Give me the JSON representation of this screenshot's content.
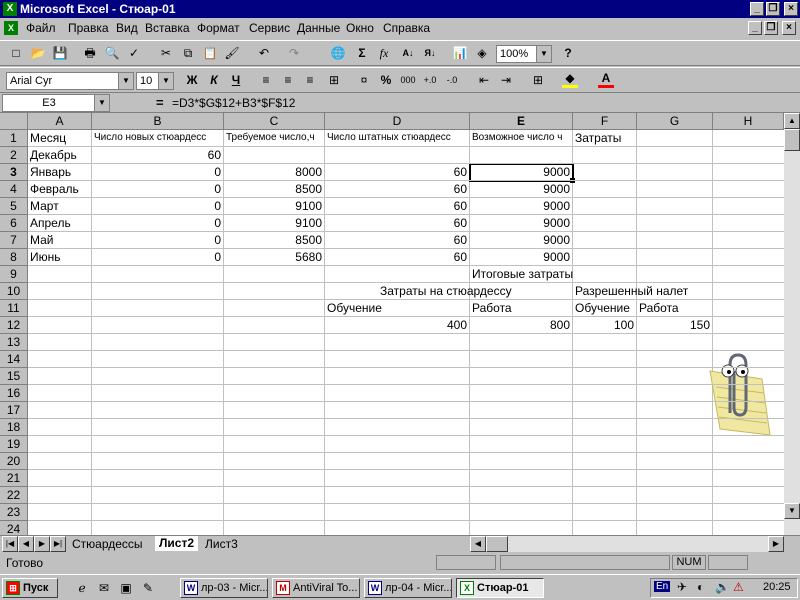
{
  "window": {
    "title": "Microsoft Excel - Стюар-01",
    "inner_controls": [
      "_",
      "❐",
      "×"
    ]
  },
  "menu": [
    "Файл",
    "Правка",
    "Вид",
    "Вставка",
    "Формат",
    "Сервис",
    "Данные",
    "Окно",
    "Справка"
  ],
  "toolbar": {
    "zoom": "100%",
    "sum_icon": "Σ",
    "fx_icon": "fx"
  },
  "format_toolbar": {
    "font": "Arial Cyr",
    "size": "10",
    "bold": "Ж",
    "italic": "К",
    "underline": "Ч",
    "percent": "%",
    "thousands": "000"
  },
  "formula_bar": {
    "name_box": "E3",
    "equals": "=",
    "formula": "=D3*$G$12+B3*$F$12"
  },
  "sheet": {
    "columns": [
      "A",
      "B",
      "C",
      "D",
      "E",
      "F",
      "G",
      "H"
    ],
    "rows": [
      "1",
      "2",
      "3",
      "4",
      "5",
      "6",
      "7",
      "8",
      "9",
      "10",
      "11",
      "12",
      "13",
      "14",
      "15",
      "16",
      "17",
      "18",
      "19",
      "20",
      "21",
      "22",
      "23",
      "24"
    ],
    "headers_row1": {
      "A": "Месяц",
      "B": "Число новых стюардесс",
      "C": "Требуемое число,ч",
      "D": "Число штатных стюардесс",
      "E": "Возможное число ч",
      "F": "Затраты"
    },
    "data": [
      {
        "A": "Декабрь",
        "B": "60",
        "C": "",
        "D": "",
        "E": ""
      },
      {
        "A": "Январь",
        "B": "0",
        "C": "8000",
        "D": "60",
        "E": "9000"
      },
      {
        "A": "Февраль",
        "B": "0",
        "C": "8500",
        "D": "60",
        "E": "9000"
      },
      {
        "A": "Март",
        "B": "0",
        "C": "9100",
        "D": "60",
        "E": "9000"
      },
      {
        "A": "Апрель",
        "B": "0",
        "C": "9100",
        "D": "60",
        "E": "9000"
      },
      {
        "A": "Май",
        "B": "0",
        "C": "8500",
        "D": "60",
        "E": "9000"
      },
      {
        "A": "Июнь",
        "B": "0",
        "C": "5680",
        "D": "60",
        "E": "9000"
      }
    ],
    "e9": "Итоговые затраты",
    "d10": "Затраты на стюардессу",
    "f10": "Разрешенный налет",
    "d11": "Обучение",
    "e11": "Работа",
    "f11": "Обучение",
    "g11": "Работа",
    "d12": "400",
    "e12": "800",
    "f12": "100",
    "g12": "150"
  },
  "tabs": [
    "Стюардессы",
    "Лист2",
    "Лист3"
  ],
  "active_tab": "Лист2",
  "status": {
    "ready": "Готово",
    "num": "NUM"
  },
  "taskbar": {
    "start": "Пуск",
    "tasks": [
      "лр-03 - Micr...",
      "AntiViral To...",
      "лр-04 - Micr...",
      "Стюар-01"
    ],
    "lang": "En",
    "clock": "20:25"
  }
}
